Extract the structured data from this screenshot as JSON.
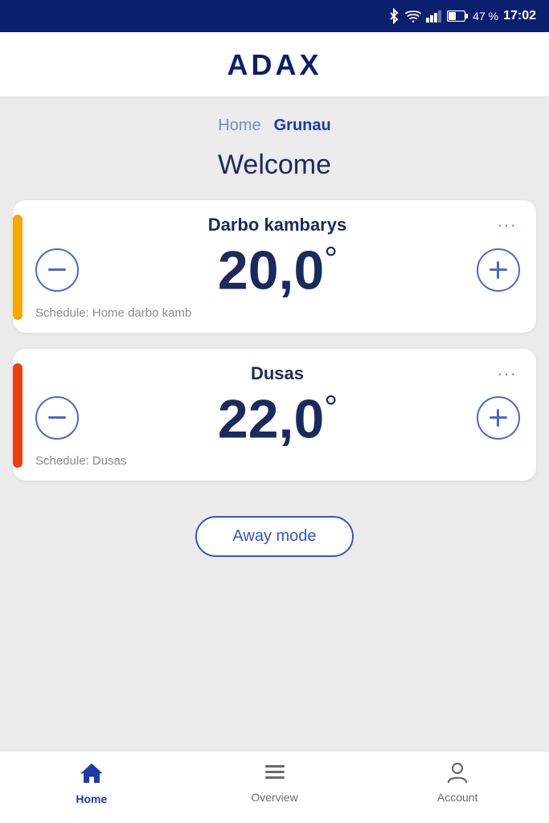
{
  "statusBar": {
    "battery": "47 %",
    "time": "17:02"
  },
  "header": {
    "logo": "ADAX"
  },
  "breadcrumb": {
    "home_label": "Home",
    "current_label": "Grunau"
  },
  "welcome": {
    "title": "Welcome"
  },
  "devices": [
    {
      "id": "darbo",
      "name": "Darbo kambarys",
      "temperature": "20,0",
      "degree_symbol": "°",
      "schedule": "Schedule: Home darbo kamb",
      "accent_color": "yellow"
    },
    {
      "id": "dusas",
      "name": "Dusas",
      "temperature": "22,0",
      "degree_symbol": "°",
      "schedule": "Schedule: Dusas",
      "accent_color": "orange"
    }
  ],
  "awayMode": {
    "label": "Away mode"
  },
  "bottomNav": {
    "items": [
      {
        "id": "home",
        "label": "Home",
        "active": true
      },
      {
        "id": "overview",
        "label": "Overview",
        "active": false
      },
      {
        "id": "account",
        "label": "Account",
        "active": false
      }
    ]
  },
  "icons": {
    "bluetooth": "⚡",
    "wifi": "▾",
    "battery": "🔋",
    "menu_dots": "···"
  }
}
